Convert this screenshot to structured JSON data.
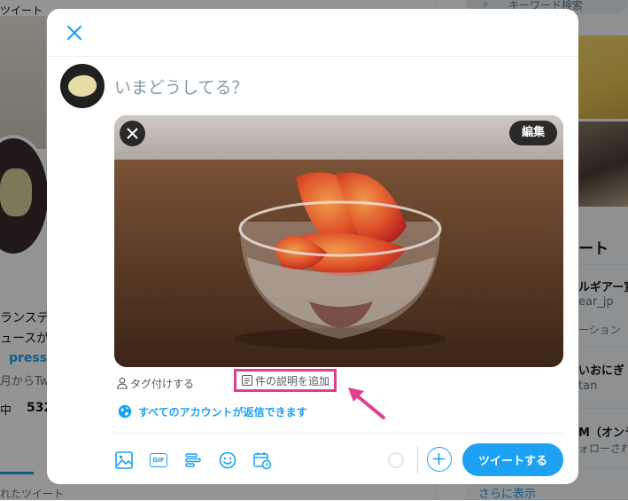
{
  "background": {
    "left": {
      "tweets_tab": "ツイート",
      "bio_line1": "ランスデザ",
      "bio_line2": "ュースが好",
      "link_text": "press.",
      "joined_text": "月からTwi",
      "follow_label": "中",
      "follow_count": "532",
      "bottom_tab": "れたツイート"
    },
    "right": {
      "search_placeholder": "キーワード検索",
      "trends_heading": "ート",
      "item1_title": "ルギアー宣",
      "item1_handle": "ear_jp",
      "item1_meta": "ーション",
      "item2_title": "いおにぎ",
      "item2_handle": "tan",
      "item3_title": "M（オンラ",
      "item3_meta": "ォローされ",
      "show_more": "さらに表示"
    }
  },
  "compose": {
    "placeholder": "いまどうしてる？",
    "media": {
      "edit_label": "編集"
    },
    "tag_people_label": "タグ付けする",
    "alt_text_label": "件の説明を追加",
    "reply_setting_label": "すべてのアカウントが返信できます",
    "toolbar": {
      "gif_label": "GIF"
    },
    "tweet_button_label": "ツイートする"
  },
  "colors": {
    "accent": "#1da1f2",
    "highlight": "#e03e8e",
    "overlay": "rgba(0,0,0,0.42)"
  }
}
